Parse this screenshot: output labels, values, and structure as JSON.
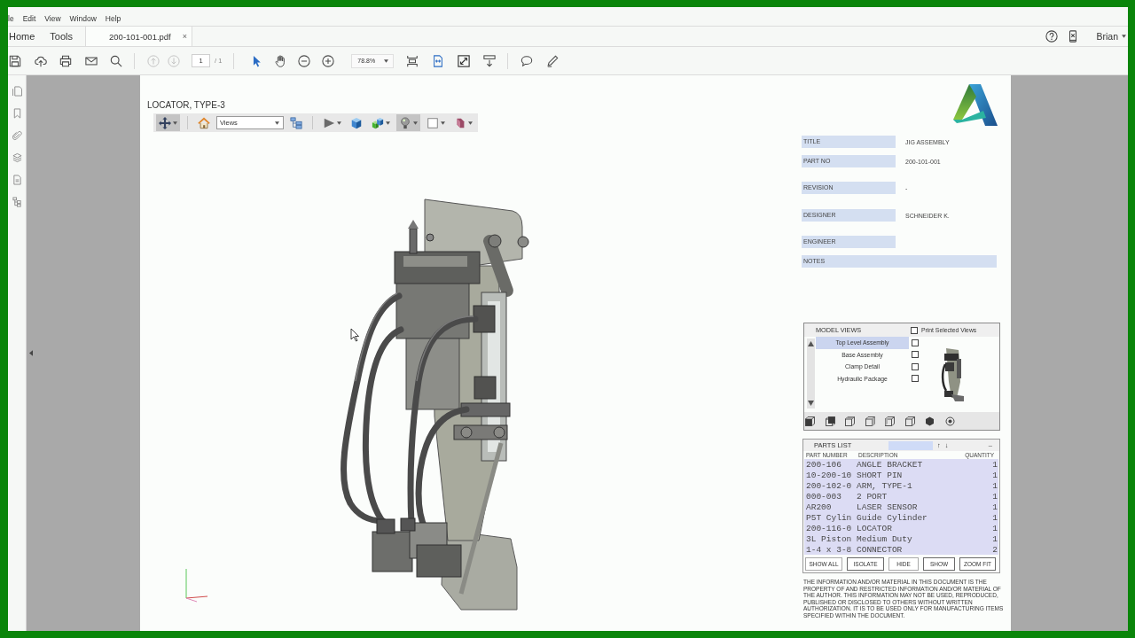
{
  "menu_bar": {
    "items": [
      "le",
      "Edit",
      "View",
      "Window",
      "Help"
    ]
  },
  "tab_bar": {
    "tabs": [
      {
        "label": "Home",
        "kind": "nav",
        "selected": false
      },
      {
        "label": "Tools",
        "kind": "nav",
        "selected": false
      },
      {
        "label": "200-101-001.pdf",
        "kind": "document",
        "selected": true,
        "close": "×"
      }
    ],
    "user": "Brian"
  },
  "toolbar": {
    "page_buttons": [
      {
        "kind": "previous",
        "disabled": true
      },
      {
        "kind": "next",
        "disabled": true
      }
    ],
    "page": "1",
    "page_total": "/ 1",
    "tools": [
      {
        "kind": "select",
        "selected": true
      },
      {
        "kind": "hand",
        "selected": false
      }
    ],
    "zoom": "78.8%"
  },
  "document": {
    "title": "LOCATOR, TYPE-3",
    "viewer_toolbar": [
      {
        "kind": "rotate",
        "pressed": true
      },
      {
        "kind": "home",
        "pressed": false
      },
      {
        "kind": "views",
        "value": "Views"
      },
      {
        "kind": "model-tree",
        "pressed": false
      },
      {
        "kind": "play",
        "pressed": false
      },
      {
        "kind": "cube",
        "pressed": false
      },
      {
        "kind": "cubes",
        "pressed": false
      },
      {
        "kind": "lighting",
        "pressed": true
      },
      {
        "kind": "background",
        "pressed": false
      },
      {
        "kind": "cross-section",
        "pressed": false
      }
    ],
    "title_block": [
      {
        "kind": "field",
        "label": "TITLE",
        "value": "JIG ASSEMBLY"
      },
      {
        "kind": "field",
        "label": "PART NO",
        "value": "200-101-001"
      },
      {
        "kind": "field",
        "label": "REVISION",
        "value": "-"
      },
      {
        "kind": "field",
        "label": "DESIGNER",
        "value": "SCHNEIDER K."
      },
      {
        "kind": "field",
        "label": "ENGINEER"
      },
      {
        "kind": "wide",
        "label": "NOTES"
      }
    ],
    "model_views": {
      "title": "MODEL VIEWS",
      "print_selected": {
        "label": "Print Selected Views",
        "checked": false
      },
      "items": [
        {
          "label": "Top Level Assembly",
          "selected": true,
          "checked": false
        },
        {
          "label": "Base Assembly",
          "selected": false,
          "checked": false
        },
        {
          "label": "Clamp Detail",
          "selected": false,
          "checked": false
        },
        {
          "label": "Hydraulic Package",
          "selected": false,
          "checked": false
        }
      ]
    },
    "parts_list": {
      "title": "PARTS LIST",
      "sort_up": "↑",
      "sort_down": "↓",
      "collapse": "–",
      "columns": [
        "PART NUMBER",
        "DESCRIPTION",
        "QUANTITY"
      ],
      "rows": [
        {
          "part_number": "200-106",
          "description": "ANGLE BRACKET",
          "quantity": "1"
        },
        {
          "part_number": "10-200-10",
          "description": "SHORT PIN",
          "quantity": "1"
        },
        {
          "part_number": "200-102-0",
          "description": "ARM, TYPE-1",
          "quantity": "1"
        },
        {
          "part_number": "000-003",
          "description": "2 PORT",
          "quantity": "1"
        },
        {
          "part_number": "AR200",
          "description": "LASER SENSOR",
          "quantity": "1"
        },
        {
          "part_number": "P5T Cylin",
          "description": "Guide Cylinder",
          "quantity": "1"
        },
        {
          "part_number": "200-116-0",
          "description": "LOCATOR",
          "quantity": "1"
        },
        {
          "part_number": "3L Piston",
          "description": "Medium Duty",
          "quantity": "1"
        },
        {
          "part_number": "1-4 x 3-8",
          "description": "CONNECTOR",
          "quantity": "2"
        }
      ],
      "buttons": [
        "SHOW ALL",
        "ISOLATE",
        "HIDE",
        "SHOW",
        "ZOOM FIT"
      ]
    },
    "disclaimer": "THE INFORMATION AND/OR MATERIAL IN THIS DOCUMENT IS THE PROPERTY OF AND RESTRICTED INFORMATION AND/OR MATERIAL OF THE AUTHOR. THIS INFORMATION MAY NOT BE USED, REPRODUCED, PUBLISHED OR DISCLOSED TO OTHERS WITHOUT WRITTEN AUTHORIZATION.  IT IS TO BE USED ONLY FOR MANUFACTURING ITEMS SPECIFIED WITHIN THE DOCUMENT."
  }
}
